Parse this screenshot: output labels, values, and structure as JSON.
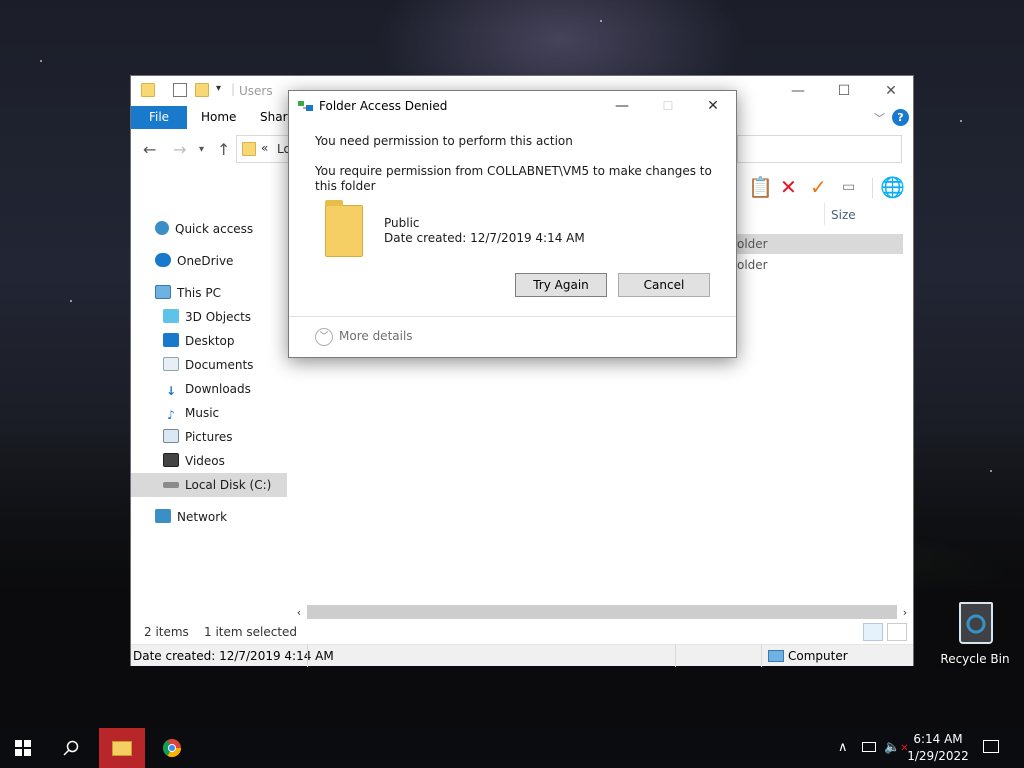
{
  "explorer": {
    "title": "Users",
    "tabs": [
      "File",
      "Home",
      "Share"
    ],
    "address_fragment": "Lo",
    "column_size": "Size",
    "file_rows": [
      "older",
      "older"
    ],
    "nav": {
      "quick_access": "Quick access",
      "onedrive": "OneDrive",
      "this_pc": "This PC",
      "objects3d": "3D Objects",
      "desktop": "Desktop",
      "documents": "Documents",
      "downloads": "Downloads",
      "music": "Music",
      "pictures": "Pictures",
      "videos": "Videos",
      "local_disk": "Local Disk (C:)",
      "network": "Network"
    },
    "status": {
      "items": "2 items",
      "selected": "1 item selected"
    },
    "details": {
      "date_created": "Date created: 12/7/2019 4:14 AM",
      "location": "Computer"
    }
  },
  "dialog": {
    "title": "Folder Access Denied",
    "message_heading": "You need permission to perform this action",
    "message_body": "You require permission from COLLABNET\\VM5 to make changes to this folder",
    "item_name": "Public",
    "item_date": "Date created: 12/7/2019 4:14 AM",
    "try_again_label": "Try Again",
    "cancel_label": "Cancel",
    "more_details_label": "More details"
  },
  "desktop": {
    "recycle_bin_label": "Recycle Bin"
  },
  "taskbar": {
    "time": "6:14 AM",
    "date": "1/29/2022"
  },
  "colors": {
    "accent": "#1979ca",
    "taskbar_active": "#b9262a",
    "delete_red": "#e81123",
    "check_orange": "#e8761a"
  }
}
